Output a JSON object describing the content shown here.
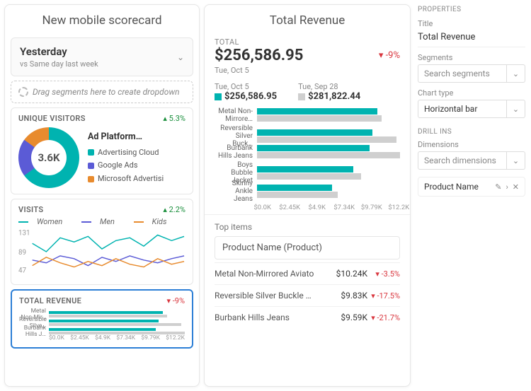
{
  "left": {
    "title": "New mobile scorecard",
    "date_picker": {
      "main": "Yesterday",
      "sub": "vs Same day last week"
    },
    "dropzone": "Drag segments here to create dropdown",
    "unique_visitors": {
      "label": "UNIQUE VISITORS",
      "delta": "5.3%",
      "center": "3.6K",
      "legend_title": "Ad Platform…",
      "series": [
        {
          "name": "Advertising Cloud",
          "color": "#00b3b0"
        },
        {
          "name": "Google Ads",
          "color": "#5b5bd6"
        },
        {
          "name": "Microsoft Advertisi",
          "color": "#e88b2e"
        }
      ]
    },
    "visits": {
      "label": "VISITS",
      "delta": "2.2%",
      "series": [
        {
          "name": "Women",
          "color": "#00b3b0"
        },
        {
          "name": "Men",
          "color": "#5b5bd6"
        },
        {
          "name": "Kids",
          "color": "#e88b2e"
        }
      ],
      "yticks": [
        "131",
        "89",
        "47"
      ]
    },
    "total_revenue_card": {
      "label": "TOTAL REVENUE",
      "delta": "-9%",
      "xticks": [
        "$0.0K",
        "$2.45K",
        "$4.9K",
        "$7.34K",
        "$9.79K",
        "$12.2K"
      ]
    }
  },
  "detail": {
    "title": "Total Revenue",
    "section_label": "TOTAL",
    "total_value": "$256,586.95",
    "total_delta": "-9%",
    "total_date": "Tue, Oct 5",
    "compare": [
      {
        "date": "Tue, Oct 5",
        "value": "$256,586.95",
        "color": "#00b3b0"
      },
      {
        "date": "Tue, Sep 28",
        "value": "$281,822.44",
        "color": "#cfcfcf"
      }
    ],
    "xticks": [
      "$0.0K",
      "$2.45K",
      "$4.9K",
      "$7.34K",
      "$9.79K",
      "$12.2K"
    ],
    "top_items_label": "Top items",
    "dimension_picker": "Product Name (Product)"
  },
  "chart_data": {
    "type": "bar",
    "orientation": "horizontal",
    "xlabel": "",
    "ylabel": "",
    "xlim": [
      0,
      12200
    ],
    "xticks": [
      0,
      2450,
      4900,
      7340,
      9790,
      12200
    ],
    "categories": [
      "Metal Non-Mirrore…",
      "Reversible Silver Buck…",
      "Burbank Hills Jeans",
      "Boys Bubble Jacket",
      "Skinny Ankle Jeans"
    ],
    "series": [
      {
        "name": "Tue, Oct 5",
        "color": "#00b3b0",
        "values": [
          10240,
          9830,
          9590,
          8200,
          6400
        ]
      },
      {
        "name": "Tue, Sep 28",
        "color": "#cfcfcf",
        "values": [
          10600,
          11900,
          12200,
          8900,
          6900
        ]
      }
    ]
  },
  "top_items": [
    {
      "name": "Metal Non-Mirrored Aviato",
      "value": "$10.24K",
      "delta": "-3.5%"
    },
    {
      "name": "Reversible Silver Buckle …",
      "value": "$9.83K",
      "delta": "-17.5%"
    },
    {
      "name": "Burbank Hills Jeans",
      "value": "$9.59K",
      "delta": "-21.7%"
    }
  ],
  "properties": {
    "header": "PROPERTIES",
    "title_label": "Title",
    "title_value": "Total Revenue",
    "segments_label": "Segments",
    "segments_placeholder": "Search segments",
    "chart_type_label": "Chart type",
    "chart_type_value": "Horizontal bar",
    "drill_header": "DRILL INS",
    "dimensions_label": "Dimensions",
    "dimensions_placeholder": "Search dimensions",
    "drill_item": "Product Name"
  },
  "mini_bars": {
    "max": 12200,
    "rows": [
      {
        "name": "Metal Non-Mir…",
        "a": 10240,
        "b": 10600
      },
      {
        "name": "Reversible Silve…",
        "a": 9830,
        "b": 11900
      },
      {
        "name": "Burbank Hills J…",
        "a": 9590,
        "b": 12200
      }
    ]
  }
}
